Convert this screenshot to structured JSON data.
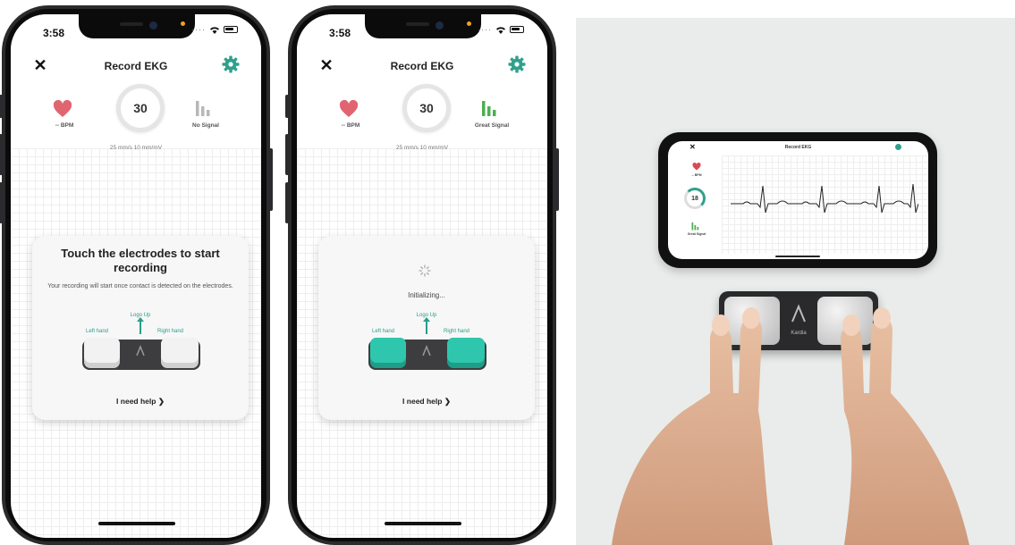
{
  "screens": [
    {
      "status_time": "3:58",
      "title": "Record EKG",
      "bpm": "-- BPM",
      "countdown": "30",
      "signal": "No Signal",
      "scale": "25 mm/s  10 mm/mV",
      "card_heading": "Touch the electrodes to start recording",
      "card_text": "Your recording will start once contact is detected on the electrodes.",
      "logo_up": "Logo Up",
      "left_hand": "Left hand",
      "right_hand": "Right hand",
      "help": "I need help"
    },
    {
      "status_time": "3:58",
      "title": "Record EKG",
      "bpm": "-- BPM",
      "countdown": "30",
      "signal": "Great Signal",
      "scale": "25 mm/s  10 mm/mV",
      "status": "Initializing...",
      "logo_up": "Logo Up",
      "left_hand": "Left hand",
      "right_hand": "Right hand",
      "help": "I need help"
    }
  ],
  "photo": {
    "landscape_title": "Record EKG",
    "landscape_bpm": "-- BPM",
    "landscape_countdown": "18",
    "landscape_signal": "Great Signal",
    "device_brand": "Kardia"
  },
  "colors": {
    "accent": "#2fa08c",
    "heart": "#e06570",
    "pad_active": "#2ec7ad",
    "no_signal": "#b8b8b8",
    "great_signal": "#4caf50"
  },
  "icons": {
    "close": "close-icon",
    "settings": "gear-icon",
    "heart": "heart-icon",
    "signal": "signal-bars-icon",
    "chevron": "chevron-right-icon",
    "spinner": "spinner-icon"
  }
}
